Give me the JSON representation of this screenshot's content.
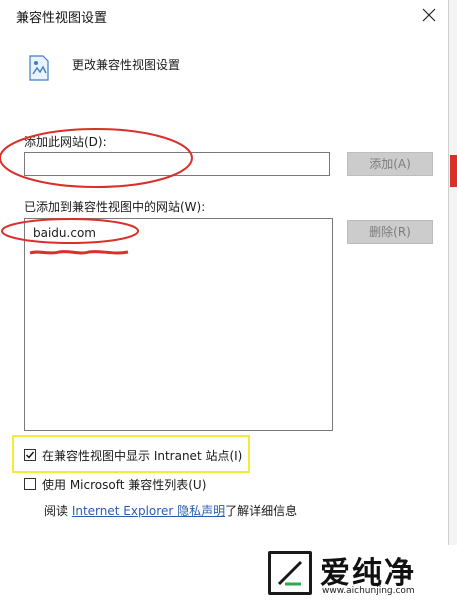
{
  "window": {
    "title": "兼容性视图设置"
  },
  "header": {
    "text": "更改兼容性视图设置"
  },
  "add_section": {
    "label": "添加此网站(D):",
    "input_value": "",
    "add_button": "添加(A)"
  },
  "list_section": {
    "label": "已添加到兼容性视图中的网站(W):",
    "items": [
      "baidu.com"
    ],
    "remove_button": "删除(R)"
  },
  "options": {
    "intranet": {
      "label": "在兼容性视图中显示 Intranet 站点(I)",
      "checked": true
    },
    "ms_list": {
      "label": "使用 Microsoft 兼容性列表(U)",
      "checked": false
    }
  },
  "info": {
    "prefix": "阅读 ",
    "link": "Internet Explorer 隐私声明",
    "suffix": "了解详细信息"
  },
  "watermark": {
    "text": "爱纯净",
    "url": "www.aichunjing.com"
  },
  "colors": {
    "annotation_red": "#d9302b",
    "annotation_yellow": "#f4ec3a",
    "link": "#2a5db0"
  }
}
